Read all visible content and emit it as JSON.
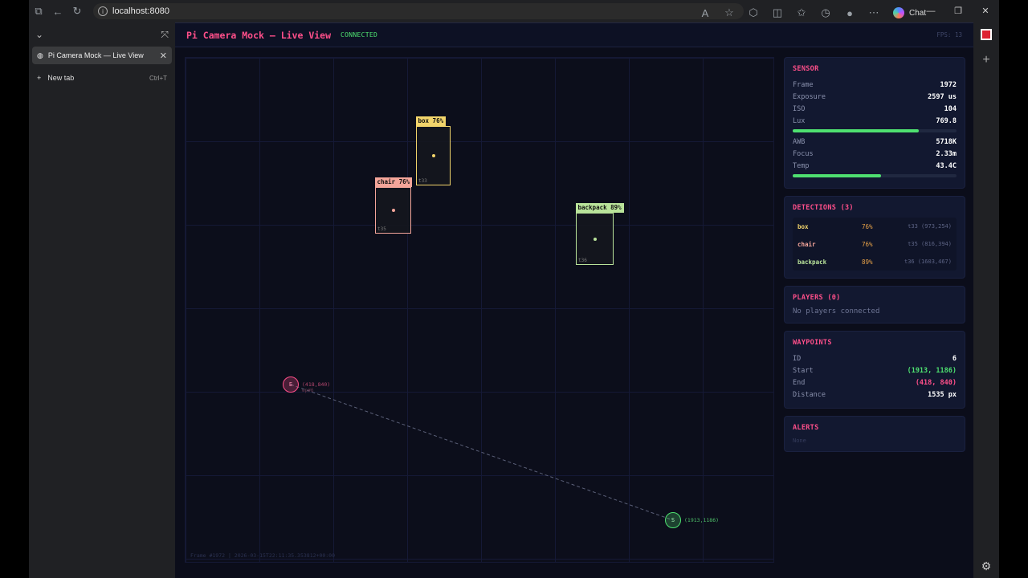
{
  "browser": {
    "url": "localhost:8080",
    "chat_label": "Chat",
    "tabs": [
      {
        "title": "Pi Camera Mock — Live View"
      }
    ],
    "new_tab_label": "New tab",
    "new_tab_shortcut": "Ctrl+T"
  },
  "app": {
    "title": "Pi Camera Mock — Live View",
    "status": "CONNECTED",
    "fps": "FPS: 13",
    "footer": "Frame #1972  |  2026-03-15T22:11:35.353812+00:00"
  },
  "detections_overlay": [
    {
      "label": "box 76%",
      "track": "t33",
      "color": "#f2d46b"
    },
    {
      "label": "chair 76%",
      "track": "t35",
      "color": "#f4a59a"
    },
    {
      "label": "backpack 89%",
      "track": "t36",
      "color": "#b9e39a"
    }
  ],
  "waypoint_markers": {
    "start": {
      "symbol": "S",
      "coord": "(1913,1186)",
      "color": "#4ee070"
    },
    "end": {
      "symbol": "E",
      "coord": "(418,840)",
      "sub": "wp#6",
      "color": "#ff4f8a"
    }
  },
  "sensor": {
    "title": "SENSOR",
    "rows": [
      {
        "k": "Frame",
        "v": "1972"
      },
      {
        "k": "Exposure",
        "v": "2597 us"
      },
      {
        "k": "ISO",
        "v": "104"
      },
      {
        "k": "Lux",
        "v": "769.8"
      },
      {
        "k": "AWB",
        "v": "5718K"
      },
      {
        "k": "Focus",
        "v": "2.33m"
      },
      {
        "k": "Temp",
        "v": "43.4C"
      }
    ],
    "lux_level": 0.77,
    "temp_level": 0.54
  },
  "detections": {
    "title": "DETECTIONS (3)",
    "items": [
      {
        "name": "box",
        "conf": "76%",
        "meta": "t33 (973,254)",
        "color": "#f2d46b"
      },
      {
        "name": "chair",
        "conf": "76%",
        "meta": "t35 (816,394)",
        "color": "#f4a59a"
      },
      {
        "name": "backpack",
        "conf": "89%",
        "meta": "t36 (1603,467)",
        "color": "#b9e39a"
      }
    ]
  },
  "players": {
    "title": "PLAYERS (0)",
    "empty": "No players connected"
  },
  "waypoints": {
    "title": "WAYPOINTS",
    "rows": [
      {
        "k": "ID",
        "v": "6",
        "color": "#ffffff"
      },
      {
        "k": "Start",
        "v": "(1913, 1186)",
        "color": "#4ee070"
      },
      {
        "k": "End",
        "v": "(418, 840)",
        "color": "#ff4f8a"
      },
      {
        "k": "Distance",
        "v": "1535 px",
        "color": "#ffffff"
      }
    ]
  },
  "alerts": {
    "title": "ALERTS",
    "empty": "None"
  }
}
